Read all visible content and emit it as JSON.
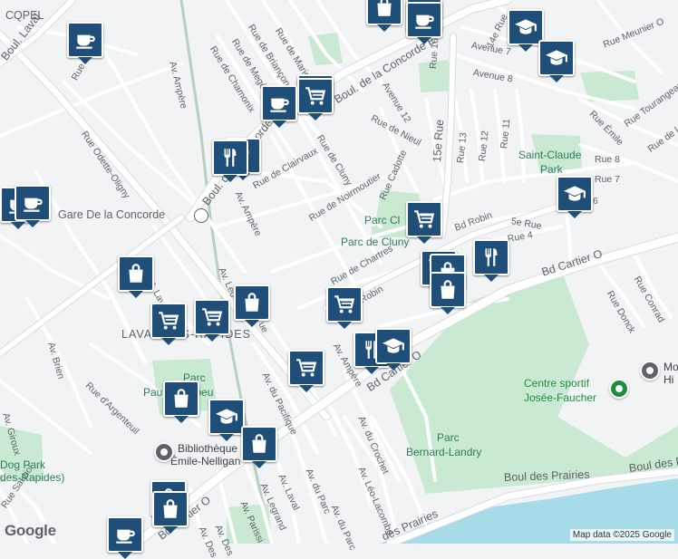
{
  "map": {
    "labels": {
      "cqpel": "CQPEL",
      "boul_laval": "Boul. Laval",
      "boul_laval_2": "Boul. Laval",
      "rue_st_elie": "Rue St-Élie",
      "rue_odette": "Rue Odette-Oligny",
      "av_ampere_top": "Av. Ampère",
      "av_ampere_mid": "Av. Ampère",
      "av_ampere_low": "Av. Ampère",
      "rue_marigny": "Rue de Marigny",
      "rue_briancon": "Rue de Briançon",
      "rue_megeve": "Rue de Megève",
      "rue_chamonix": "Rue de Chamonix",
      "boul_concorde_e": "Boul. de la Concorde E",
      "boul_concorde_o": "Boul. de la Concorde O.",
      "avenue_12": "Avenue 12",
      "avenue_7": "Avenue 7",
      "avenue_8": "Avenue 8",
      "rue_16": "Rue 16",
      "rue_14e": "14e Rue",
      "rue_meunier": "Rue Meunier O",
      "rue_nieul": "Rue de Nieul",
      "rue_cluny": "Rue de Cluny",
      "rue_clairvaux": "Rue de Clairvaux",
      "rue_noirmoutier": "Rue de Noirmoutier",
      "rue_cadotte": "Rue Cadotte",
      "rue_15e": "15e Rue",
      "rue_13": "Rue 13",
      "rue_12": "Rue 12",
      "rue_11": "Rue 11",
      "rue_emile": "Rue Émile",
      "rue_tourangeau": "Rue Tourangeau",
      "rue_de_l": "Rue de l",
      "rue_8": "Rue 8",
      "rue_7": "Rue 7",
      "rue_6": "6",
      "rue_5e": "5e Rue",
      "rue_4": "Rue 4",
      "bd_robin": "Bd Robin",
      "bd_robin_2": "Robin",
      "rue_chartres": "Rue de Chartres",
      "gare": "Gare De la Concorde",
      "bd_cartier_o": "Bd Cartier O",
      "bd_cartier_o_2": "Bd Cartier O",
      "bd_cartier_o_3": "Bd Cartier O",
      "rue_donck": "Rue Donck",
      "rue_conrad": "Rue Conrad",
      "av_leo_top": "Av. Léo-",
      "av_pacifique_top": "ue",
      "av_pacifique": "Av. du Pacifique",
      "av_brien": "Av. Brien",
      "rue_argenteuil": "Rue d'Argenteuil",
      "av_giroux": "Av. Giroux",
      "av_du_parc": "Av. du Parc",
      "av_du_parc_2": "Av. du Parc",
      "av_crochet": "Av. du Crochet",
      "av_leo_lacombe": "Av. Léo-Lacombe",
      "av_legrand": "Av. Legrand",
      "av_laval": "Av. Laval",
      "av_parissi": "Av. Parissi",
      "av_des": "Av. Des",
      "av_des_2": "Av. Des",
      "av_a": "Av. A",
      "boul_des_prairies": "Boul des Prairies",
      "boul_des_prairies_2": "Boul des Prairies",
      "des_prairies": "des Prairies",
      "boul_laval_diag": "Boul. Laval",
      "rue_sauriol": "Rue Sauriol",
      "rue_gilli": "Rue Gilli",
      "av_pascal": "Av. Pa",
      "av_ampere_s": "Av. Ampère",
      "bd_cartier_n": "Bd Cartier O"
    },
    "areas": {
      "laval_des_rapides": "LAVAL-DES-RAPIDES",
      "saint_claude_park": "Saint-Claude Park",
      "parc_cl": "Parc Cl",
      "parc_de_cluny": "Parc de Cluny",
      "parc_pauline": "Parc Pauline-Julien-Mabeu",
      "parc_pauline_line1": "Parc",
      "parc_pauline_line2": "Paul      el-Mabeu",
      "parc_bernard_1": "Parc",
      "parc_bernard_2": "Bernard-Landry",
      "centre_sportif_1": "Centre sportif",
      "centre_sportif_2": "Josée-Faucher",
      "mo_hi_1": "Mo",
      "mo_hi_2": "Hi",
      "biblio_1": "Bibliothèque",
      "biblio_2": "Émile-Nelligan",
      "dog_park_1": "Dog Park",
      "dog_park_2": "des-Rapides)"
    },
    "markers": [
      {
        "type": "bag",
        "icon": "shopping-bag-icon"
      },
      {
        "type": "coffee",
        "icon": "coffee-cup-icon"
      },
      {
        "type": "coffee",
        "icon": "coffee-cup-icon"
      },
      {
        "type": "coffee",
        "icon": "coffee-cup-icon"
      },
      {
        "type": "school",
        "icon": "graduation-cap-icon"
      },
      {
        "type": "school",
        "icon": "graduation-cap-icon"
      },
      {
        "type": "coffee",
        "icon": "coffee-cup-icon"
      },
      {
        "type": "cart",
        "icon": "shopping-cart-icon"
      },
      {
        "type": "coffee",
        "icon": "coffee-cup-icon"
      },
      {
        "type": "food",
        "icon": "restaurant-icon"
      },
      {
        "type": "food",
        "icon": "restaurant-icon"
      },
      {
        "type": "coffee",
        "icon": "coffee-cup-icon"
      },
      {
        "type": "coffee",
        "icon": "coffee-cup-icon"
      },
      {
        "type": "school",
        "icon": "graduation-cap-icon"
      },
      {
        "type": "cart",
        "icon": "shopping-cart-icon"
      },
      {
        "type": "cart",
        "icon": "shopping-cart-icon"
      },
      {
        "type": "bag",
        "icon": "shopping-bag-icon"
      },
      {
        "type": "food",
        "icon": "restaurant-icon"
      },
      {
        "type": "bag",
        "icon": "shopping-bag-icon"
      },
      {
        "type": "bag",
        "icon": "shopping-bag-icon"
      },
      {
        "type": "cart",
        "icon": "shopping-cart-icon"
      },
      {
        "type": "cart",
        "icon": "shopping-cart-icon"
      },
      {
        "type": "bag",
        "icon": "shopping-bag-icon"
      },
      {
        "type": "cart",
        "icon": "shopping-cart-icon"
      },
      {
        "type": "food",
        "icon": "restaurant-icon"
      },
      {
        "type": "school",
        "icon": "graduation-cap-icon"
      },
      {
        "type": "cart",
        "icon": "shopping-cart-icon"
      },
      {
        "type": "bag",
        "icon": "shopping-bag-icon"
      },
      {
        "type": "school",
        "icon": "graduation-cap-icon"
      },
      {
        "type": "bag",
        "icon": "shopping-bag-icon"
      },
      {
        "type": "bag",
        "icon": "shopping-bag-icon"
      },
      {
        "type": "bag",
        "icon": "shopping-bag-icon"
      },
      {
        "type": "coffee",
        "icon": "coffee-cup-icon"
      }
    ],
    "footer": {
      "google_logo": "Google",
      "attribution": "Map data ©2025 Google"
    },
    "colors": {
      "road": "#ffffff",
      "road_casing": "#dadce0",
      "background": "#f1f3f4",
      "park": "#c9e9d2",
      "water": "#a8dbe8",
      "marker": "#1f4e79",
      "rail": "#b8cfc2"
    }
  }
}
